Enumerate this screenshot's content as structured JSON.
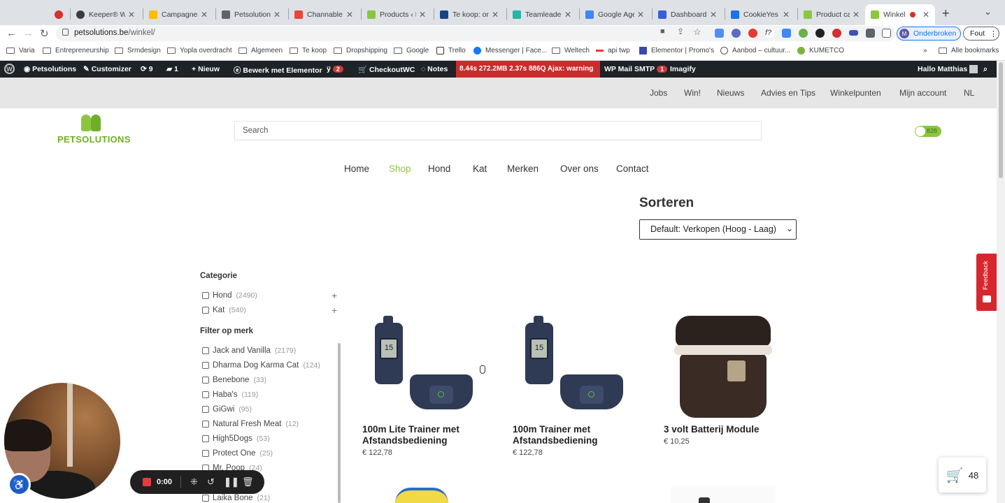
{
  "browser": {
    "tabs": [
      {
        "title": "",
        "color": "#d93025",
        "active": false
      },
      {
        "title": "Keeper® Wa",
        "color": "#3c3c3c",
        "active": false
      },
      {
        "title": "Campagnes",
        "color": "#fbbc04",
        "active": false
      },
      {
        "title": "Petsolutions",
        "color": "#5f6368",
        "active": false
      },
      {
        "title": "Channable",
        "color": "#e8453c",
        "active": false
      },
      {
        "title": "Products ‹ P",
        "color": "#8cc63f",
        "active": false
      },
      {
        "title": "Te koop: onl",
        "color": "#1a4480",
        "active": false
      },
      {
        "title": "Teamleader",
        "color": "#25b6a4",
        "active": false
      },
      {
        "title": "Google Agen",
        "color": "#4285f4",
        "active": false
      },
      {
        "title": "Dashboard",
        "color": "#3b5bdb",
        "active": false
      },
      {
        "title": "CookieYes",
        "color": "#1a73e8",
        "active": false
      },
      {
        "title": "Product cat",
        "color": "#8cc63f",
        "active": false
      },
      {
        "title": "Winkel -",
        "color": "#8cc63f",
        "active": true
      }
    ],
    "url_host": "petsolutions.be",
    "url_path": "/winkel/",
    "profile_label": "Onderbroken",
    "profile_initial": "M",
    "error_label": "Fout",
    "bookmarks": [
      "Varia",
      "Entrepreneurship",
      "Srmdesign",
      "Yopla overdracht",
      "Algemeen",
      "Te koop",
      "Dropshipping",
      "Google",
      "Trello",
      "Messenger | Face...",
      "Weltech",
      "api twp",
      "Elementor | Promo's",
      "Aanbod – cultuur...",
      "KUMETCO"
    ],
    "bookmarks_more": "»",
    "all_bookmarks": "Alle bookmarks"
  },
  "wp_admin": {
    "site": "Petsolutions",
    "customizer": "Customizer",
    "updates": "9",
    "comments": "1",
    "new": "Nieuw",
    "elementor": "Bewerk met Elementor",
    "yoast_badge": "2",
    "checkout": "CheckoutWC",
    "notes": "Notes",
    "perf": "8.44s  272.2MB  2.37s  886Q  Ajax: warning",
    "mail": "WP Mail SMTP",
    "mail_badge": "1",
    "imagify": "Imagify",
    "greeting": "Hallo Matthias"
  },
  "top_menu": [
    "Jobs",
    "Win!",
    "Nieuws",
    "Advies en Tips",
    "Winkelpunten",
    "Mijn account",
    "NL"
  ],
  "header": {
    "logo_text": "PETSOLUTIONS",
    "search_placeholder": "Search",
    "b2b_label": "B2B"
  },
  "main_menu": [
    "Home",
    "Shop",
    "Hond",
    "Kat",
    "Merken",
    "Over ons",
    "Contact"
  ],
  "sort": {
    "label": "Sorteren",
    "selected": "Default: Verkopen (Hoog - Laag)"
  },
  "sidebar": {
    "category_title": "Categorie",
    "categories": [
      {
        "name": "Hond",
        "count": "(2490)"
      },
      {
        "name": "Kat",
        "count": "(540)"
      }
    ],
    "brand_title": "Filter op merk",
    "brands": [
      {
        "name": "Jack and Vanilla",
        "count": "(2179)"
      },
      {
        "name": "Dharma Dog Karma Cat",
        "count": "(124)"
      },
      {
        "name": "Benebone",
        "count": "(33)"
      },
      {
        "name": "Haba's",
        "count": "(119)"
      },
      {
        "name": "GiGwi",
        "count": "(95)"
      },
      {
        "name": "Natural Fresh Meat",
        "count": "(12)"
      },
      {
        "name": "High5Dogs",
        "count": "(53)"
      },
      {
        "name": "Protect One",
        "count": "(25)"
      },
      {
        "name": "Mr. Poop",
        "count": "(24)"
      },
      {
        "name": "Laika Bone",
        "count": "(21)"
      }
    ]
  },
  "products": [
    {
      "name": "100m Lite Trainer met Afstandsbediening",
      "price": "€ 122,78"
    },
    {
      "name": "100m Trainer met Afstandsbediening",
      "price": "€ 122,78"
    },
    {
      "name": "3 volt Batterij Module",
      "price": "€ 10,25"
    }
  ],
  "trainer_display": "15",
  "feedback": "Feedback",
  "cart_count": "48",
  "recorder": {
    "time": "0:00"
  },
  "colors": {
    "accent_green": "#8cc63f",
    "wp_bar": "#1d2327",
    "feedback_red": "#d8262d"
  }
}
